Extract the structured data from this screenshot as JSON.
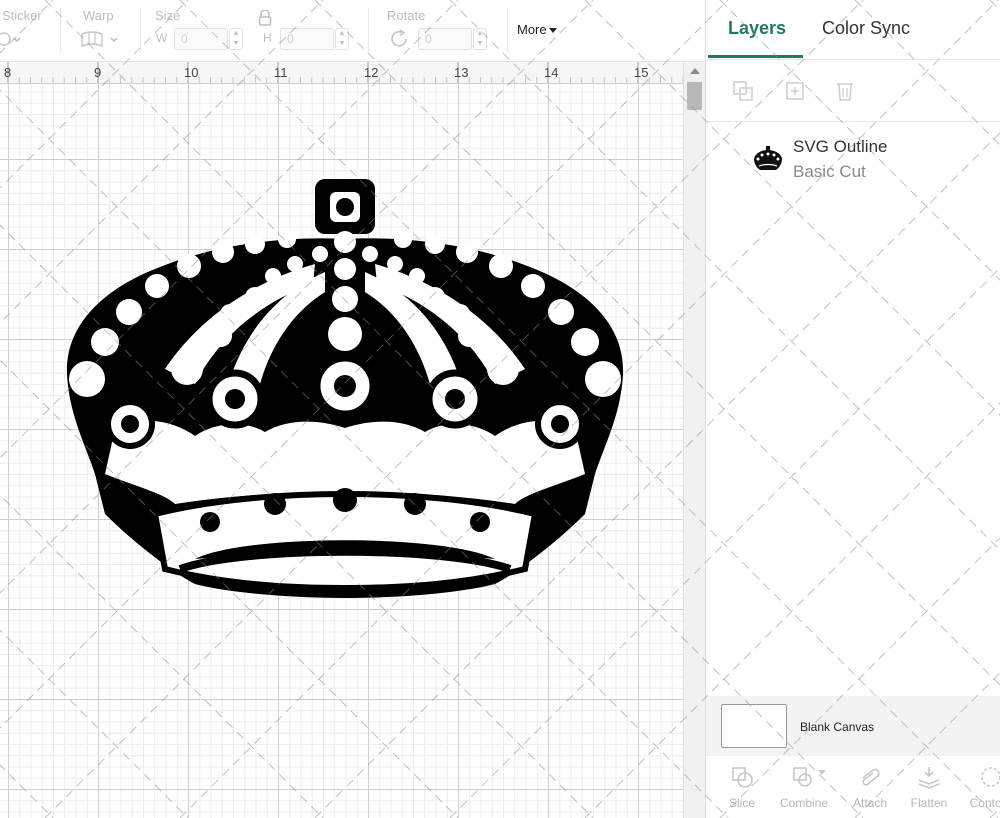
{
  "toolbar": {
    "sticker_label": "Sticker",
    "warp_label": "Warp",
    "size_label": "Size",
    "width_prefix": "W",
    "width_value": "0",
    "height_prefix": "H",
    "height_value": "0",
    "rotate_label": "Rotate",
    "rotate_value": "0",
    "more_label": "More"
  },
  "ruler": {
    "numbers": [
      "8",
      "9",
      "10",
      "11",
      "12",
      "13",
      "14",
      "15"
    ]
  },
  "canvas": {
    "design_name": "crown-design"
  },
  "panel": {
    "tabs": [
      {
        "label": "Layers"
      },
      {
        "label": "Color Sync"
      }
    ],
    "layer": {
      "name": "SVG Outline",
      "type": "Basic Cut"
    },
    "blank_canvas_label": "Blank Canvas",
    "bottom_tools": [
      {
        "label": "Slice"
      },
      {
        "label": "Combine"
      },
      {
        "label": "Attach"
      },
      {
        "label": "Flatten"
      },
      {
        "label": "Contour"
      }
    ]
  },
  "colors": {
    "accent": "#1f7a5a",
    "grid_major": "#cfcfcf",
    "grid_minor": "#ececec"
  }
}
